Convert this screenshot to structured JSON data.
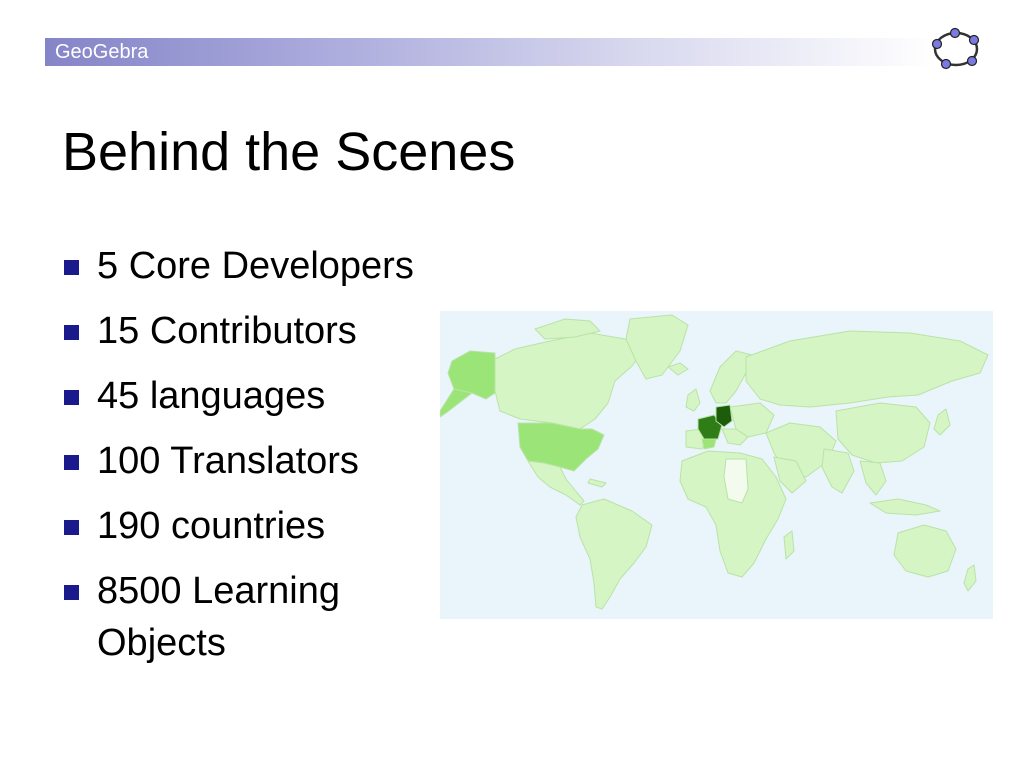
{
  "header": {
    "brand": "GeoGebra"
  },
  "title": "Behind the Scenes",
  "bullets": [
    "5 Core Developers",
    "15 Contributors",
    "45 languages",
    "100 Translators",
    "190 countries",
    "8500 Learning Objects"
  ],
  "colors": {
    "header_start": "#8484c8",
    "bullet": "#1a1a8c",
    "map_ocean": "#e9f4fb",
    "map_land_light": "#d6f5c4",
    "map_land_medium": "#9be477",
    "map_land_dark": "#2f7d16",
    "map_land_darkest": "#1d5c0b",
    "logo_vertex": "#7a7ae0"
  },
  "icons": {
    "logo": "geogebra-logo-icon",
    "bullet": "square-bullet-icon"
  }
}
